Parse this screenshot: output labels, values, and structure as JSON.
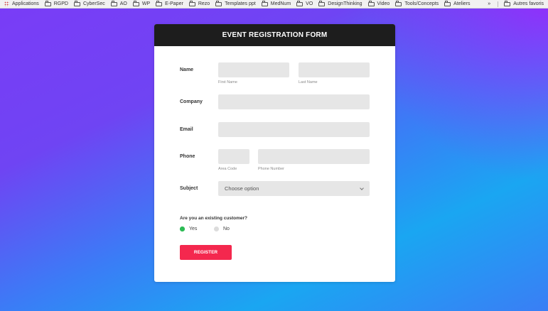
{
  "bookmarks": {
    "items": [
      "Applications",
      "RGPD",
      "CyberSec",
      "AO",
      "WP",
      "E-Paper",
      "Rezo",
      "Templates ppt",
      "MedNum",
      "VO",
      "DesignThinking",
      "Video",
      "Tools/Concepts",
      "Ateliers"
    ],
    "overflow": "»",
    "other": "Autres favoris"
  },
  "form": {
    "title": "EVENT REGISTRATION FORM",
    "name_label": "Name",
    "first_name_hint": "First Name",
    "last_name_hint": "Last Name",
    "company_label": "Company",
    "email_label": "Email",
    "phone_label": "Phone",
    "area_code_hint": "Area Code",
    "phone_number_hint": "Phone Number",
    "subject_label": "Subject",
    "subject_value": "Choose option",
    "customer_question": "Are you an existing customer?",
    "yes_label": "Yes",
    "no_label": "No",
    "register_label": "REGISTER",
    "selected_option": "Yes"
  },
  "colors": {
    "header_bg": "#1d1d1d",
    "accent_button": "#f4284e",
    "radio_selected": "#2dbb55",
    "field_bg": "#e6e6e6"
  }
}
